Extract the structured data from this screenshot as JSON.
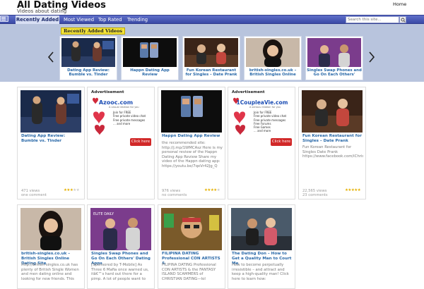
{
  "site": {
    "title": "All Dating Videos",
    "description": "Videos about dating",
    "home_label": "Home"
  },
  "nav": {
    "items": [
      "Recently Added",
      "Most Viewed",
      "Top Rated",
      "Trending"
    ],
    "menu_icon": "hamburger-icon"
  },
  "search": {
    "placeholder": "Search this site...",
    "icon": "search-icon"
  },
  "carousel": {
    "label": "Recently Added Videos",
    "items": [
      "Dating App Review: Bumble vs. Tinder",
      "Happn Dating App Review",
      "Fun Korean Restaurant for Singles – Date Prank",
      "british-singles.co.uk – British Singles Online Dating",
      "Singles Swap Phones and Go On Each Others' Dating Apps"
    ]
  },
  "ads": [
    {
      "label": "Advertisement",
      "brand": "Azooc.com",
      "tagline": "A casual relation for you",
      "lines": [
        "Join for FREE",
        "Free private video chat",
        "Free private messages",
        "... and more"
      ],
      "cta": "Click here"
    },
    {
      "label": "Advertisement",
      "brand": "1CoupleaVie.com",
      "tagline": "A serious relation for you",
      "lines": [
        "Join for FREE",
        "Free private video chat",
        "Free private messages",
        "Free Forums",
        "Free Games",
        "... and more"
      ],
      "cta": "Click here"
    }
  ],
  "videos": [
    {
      "title": "Dating App Review: Bumble vs. Tinder",
      "description": "",
      "views": "471 views",
      "comments": "one comment",
      "rating": 3
    },
    {
      "title": "Happn Dating App Review",
      "description": "the recommended site: http://j.mp/1WMCAsz Here is my personal review of the Happn Dating App Review Share my video of the Happn dating app: https://youtu.be/7qeVr42Jg_Q",
      "views": "976 views",
      "comments": "no comments",
      "rating": 4
    },
    {
      "title": "Fun Korean Restaurant for Singles – Date Prank",
      "description": "Fun Korean Restaurant for Singles Date Prank https://www.facebook.com/iChristKimi",
      "views": "22,565 views",
      "comments": "23 comments",
      "rating": 5
    },
    {
      "title": "british-singles.co.uk – British Singles Online Dating Site",
      "description": "http://british-singles.co.uk has plenty of British Single Women and men dating online and looking for new friends. This"
    },
    {
      "title": "Singles Swap Phones and Go On Each Others' Dating Apps",
      "description": "[Sponsored by T-Mobile] As Three 6 Mafia once warned us, itâ€™s hard out there for a pimp. A lot of people want to"
    },
    {
      "title": "FILIPINA DATING Professional CON ARTISTS &",
      "description": "FILIPINA DATING Professional CON ARTISTS & the FANTASY ISLAND SCAMMERS of CHRISTIAN DATING—lol"
    },
    {
      "title": "The Dating Don – How to Get a Quality Man to Court Me",
      "description": "How to become perpetually irresistible – and attract and keep a high-quality man! Click here to learn how:"
    }
  ]
}
